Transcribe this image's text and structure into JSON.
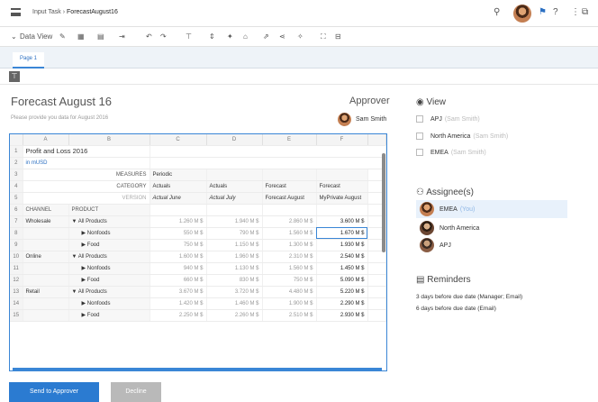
{
  "header": {
    "crumb_parent": "Input Task",
    "crumb_sep": "›",
    "crumb_current": "ForecastAugust16"
  },
  "toolbar": {
    "data_view": "Data View"
  },
  "tabs": [
    {
      "label": "Page 1"
    }
  ],
  "form": {
    "title": "Forecast August 16",
    "subtitle": "Please provide you data for August 2016",
    "approver_label": "Approver",
    "approver_name": "Sam Smith"
  },
  "grid": {
    "columns": [
      "A",
      "B",
      "C",
      "D",
      "E",
      "F"
    ],
    "report_title": "Profit and Loss 2016",
    "currency": "in mUSD",
    "measures_label": "MEASURES",
    "measures_value": "Periodic",
    "category_label": "CATEGORY",
    "categories": [
      "Actuals",
      "Actuals",
      "Forecast",
      "Forecast"
    ],
    "version_label": "VERSION",
    "versions": [
      "Actual June",
      "Actual July",
      "Forecast August",
      "MyPrivate August"
    ],
    "channel_label": "CHANNEL",
    "product_label": "PRODUCT",
    "rows": [
      {
        "n": "7",
        "channel": "Wholesale",
        "product": "▼ All Products",
        "v": [
          "1.260 M $",
          "1.940 M $",
          "2.860 M $",
          "3.600 M $"
        ]
      },
      {
        "n": "8",
        "channel": "",
        "product": "▶ Nonfoods",
        "v": [
          "550 M $",
          "790 M $",
          "1.560 M $",
          "1.670 M $"
        ]
      },
      {
        "n": "9",
        "channel": "",
        "product": "▶ Food",
        "v": [
          "750 M $",
          "1.150 M $",
          "1.300 M $",
          "1.930 M $"
        ]
      },
      {
        "n": "10",
        "channel": "Online",
        "product": "▼ All Products",
        "v": [
          "1.600 M $",
          "1.960 M $",
          "2.310 M $",
          "2.540 M $"
        ]
      },
      {
        "n": "11",
        "channel": "",
        "product": "▶ Nonfoods",
        "v": [
          "940 M $",
          "1.130 M $",
          "1.560 M $",
          "1.450 M $"
        ]
      },
      {
        "n": "12",
        "channel": "",
        "product": "▶ Food",
        "v": [
          "660 M $",
          "830 M $",
          "750 M $",
          "5.090 M $"
        ]
      },
      {
        "n": "13",
        "channel": "Retail",
        "product": "▼ All Products",
        "v": [
          "3.670 M $",
          "3.720 M $",
          "4.480 M $",
          "5.220 M $"
        ]
      },
      {
        "n": "14",
        "channel": "",
        "product": "▶ Nonfoods",
        "v": [
          "1.420 M $",
          "1.460 M $",
          "1.900 M $",
          "2.290 M $"
        ]
      },
      {
        "n": "15",
        "channel": "",
        "product": "▶ Food",
        "v": [
          "2.250 M $",
          "2.260 M $",
          "2.510 M $",
          "2.930 M $"
        ]
      }
    ]
  },
  "actions": {
    "send": "Send to Approver",
    "decline": "Decline"
  },
  "sidebar": {
    "view_title": "View",
    "views": [
      {
        "name": "APJ",
        "owner": "(Sam Smith)"
      },
      {
        "name": "North America",
        "owner": "(Sam Smith)"
      },
      {
        "name": "EMEA",
        "owner": "(Sam Smith)"
      }
    ],
    "assignees_title": "Assignee(s)",
    "assignees": [
      {
        "name": "EMEA",
        "note": "(You)"
      },
      {
        "name": "North America",
        "note": ""
      },
      {
        "name": "APJ",
        "note": ""
      }
    ],
    "reminders_title": "Reminders",
    "reminders": [
      "3 days before due date (Manager; Email)",
      "6 days before due date (Email)"
    ]
  },
  "colors": {
    "accent": "#2b7bd1",
    "decline": "#b9b9b9",
    "highlight": "#e8f1fb"
  }
}
